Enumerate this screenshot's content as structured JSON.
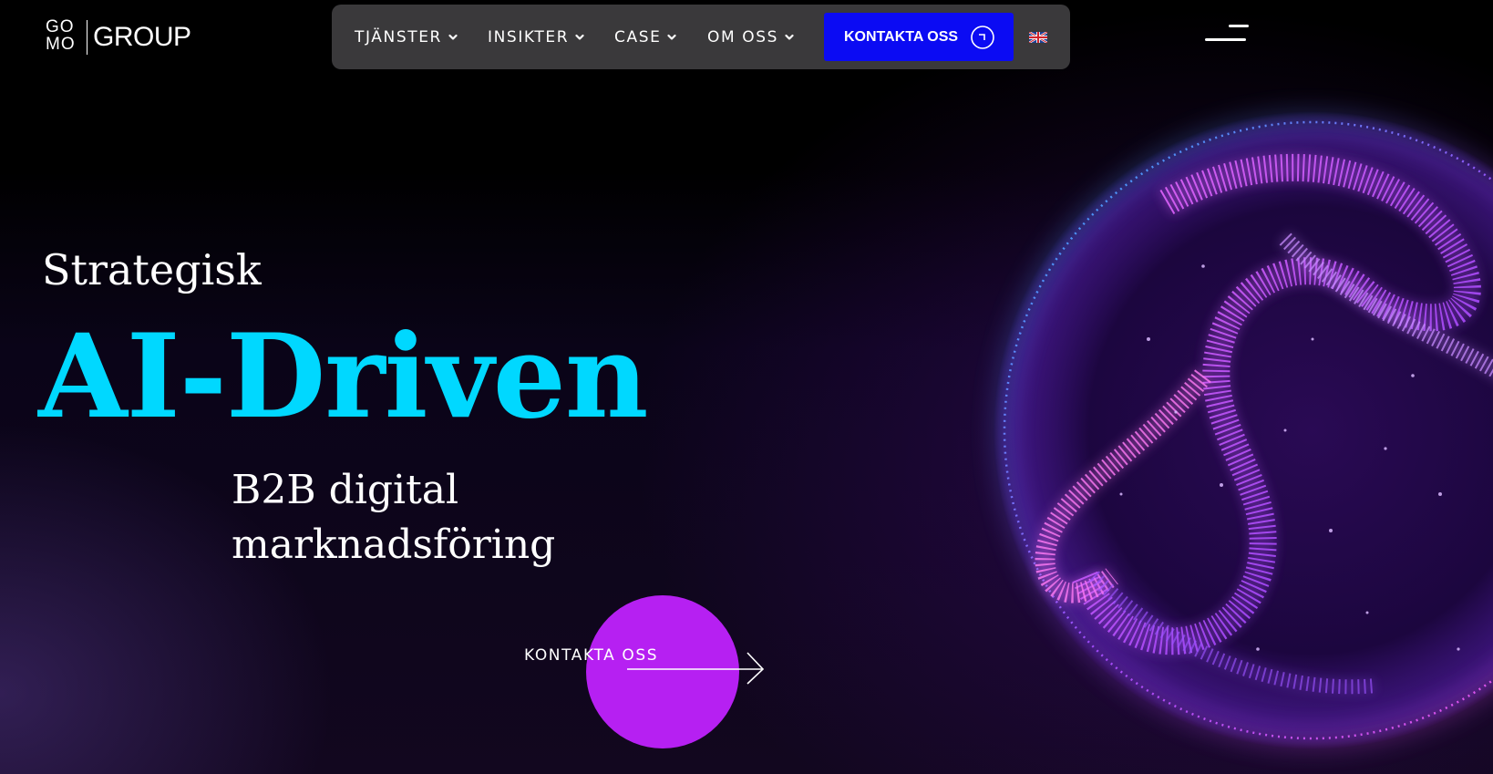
{
  "logo": {
    "top": "GO",
    "bottom": "MO",
    "word": "GROUP"
  },
  "nav": {
    "items": [
      {
        "label": "TJÄNSTER"
      },
      {
        "label": "INSIKTER"
      },
      {
        "label": "CASE"
      },
      {
        "label": "OM OSS"
      }
    ],
    "cta_label": "KONTAKTA OSS",
    "language_icon": "uk-flag-icon",
    "menu_icon": "hamburger-menu-icon"
  },
  "hero": {
    "eyebrow": "Strategisk",
    "title": "AI-Driven",
    "subtitle": "B2B digital marknadsföring",
    "cta_label": "KONTAKTA OSS"
  },
  "colors": {
    "accent_cyan": "#00d8ff",
    "cta_blue": "#0b0bf3",
    "cta_purple": "#b620f2",
    "nav_bg": "#3a393b",
    "background": "#000000"
  }
}
